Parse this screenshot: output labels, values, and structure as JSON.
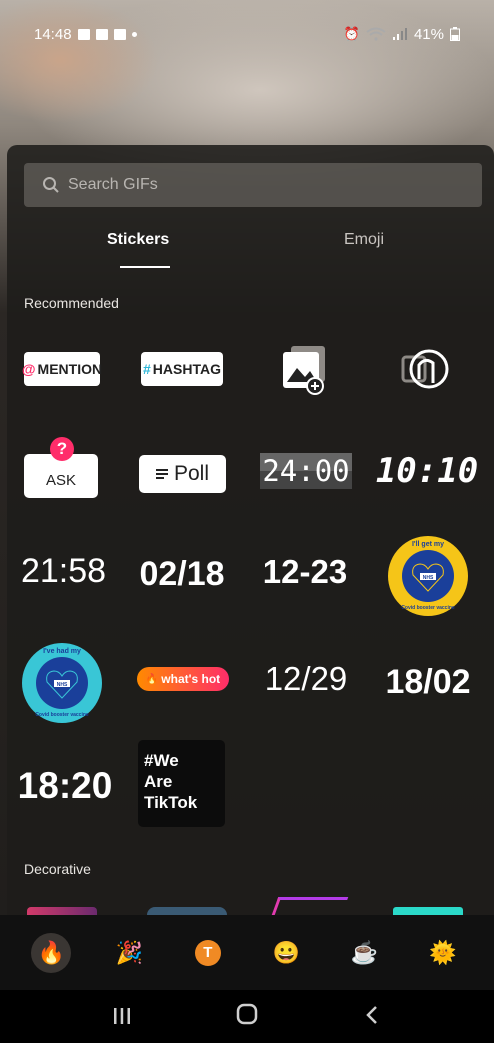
{
  "status_bar": {
    "time": "14:48",
    "battery": "41%"
  },
  "search": {
    "placeholder": "Search GIFs"
  },
  "tabs": [
    {
      "label": "Stickers",
      "active": true
    },
    {
      "label": "Emoji",
      "active": false
    }
  ],
  "sections": {
    "recommended": "Recommended",
    "decorative": "Decorative"
  },
  "stickers": {
    "mention": "MENTION",
    "hashtag": "HASHTAG",
    "ask": "ASK",
    "poll": "Poll",
    "clock_flip": "24:00",
    "clock_digital": "10:10",
    "time_1": "21:58",
    "date_1": "02/18",
    "date_2": "12-23",
    "vaccine_1_top": "I'll get my",
    "vaccine_1_bottom": "Covid booster vaccine",
    "vaccine_badge": "NHS",
    "vaccine_2_top": "I've had my",
    "vaccine_2_bottom": "Covid booster vaccine",
    "whats_hot": "what's hot",
    "date_3": "12/29",
    "date_4": "18/02",
    "time_2": "18:20",
    "we_are_tiktok": "#We Are TikTok"
  },
  "tray": [
    "fire-icon",
    "party-popper-icon",
    "text-t-icon",
    "smiley-icon",
    "coffee-icon",
    "sun-icon"
  ],
  "colors": {
    "mention_accent": "#ff2d6a",
    "hashtag_accent": "#2db7d8",
    "vaccine_yellow": "#f5c518",
    "vaccine_teal": "#39c6d6",
    "nhs_blue": "#1a3f9a"
  }
}
